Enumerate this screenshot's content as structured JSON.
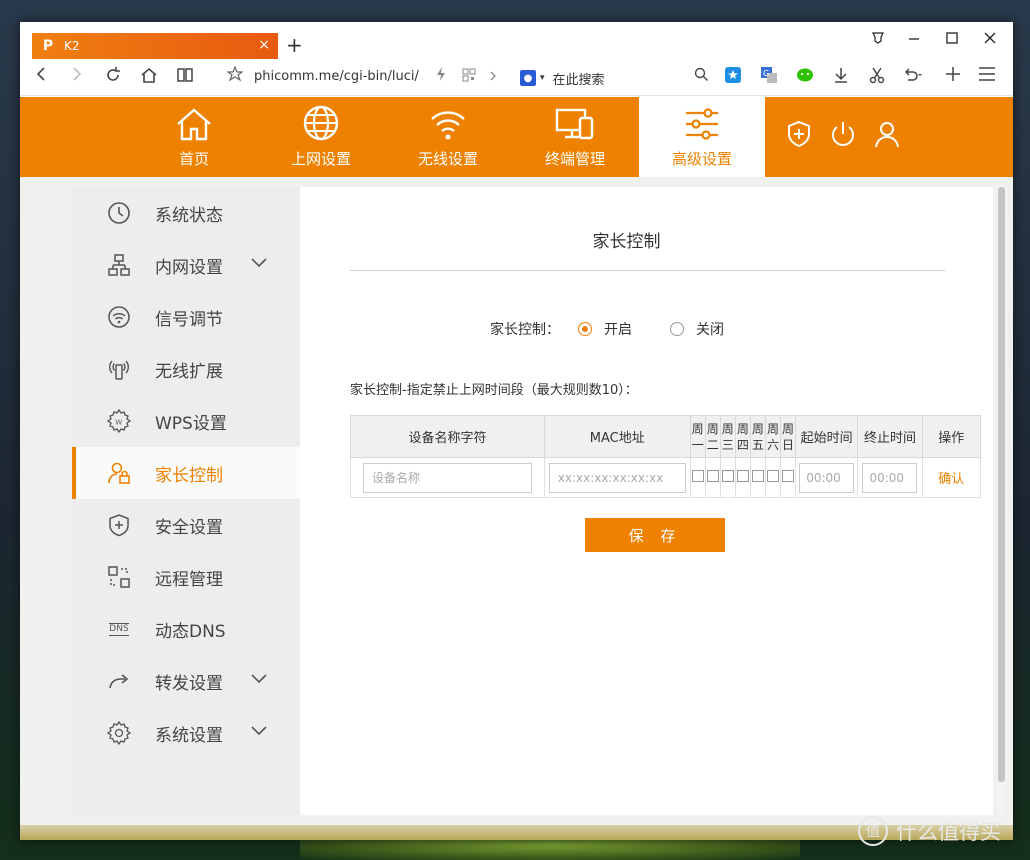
{
  "browser": {
    "tab_title": "K2",
    "tab_logo": "P",
    "tab_close": "×",
    "new_tab": "+",
    "address": "phicomm.me/cgi-bin/luci/",
    "search_placeholder": "在此搜索"
  },
  "header": {
    "menu": [
      {
        "label": "首页",
        "icon": "home-icon"
      },
      {
        "label": "上网设置",
        "icon": "globe-icon"
      },
      {
        "label": "无线设置",
        "icon": "wifi-icon"
      },
      {
        "label": "终端管理",
        "icon": "devices-icon"
      },
      {
        "label": "高级设置",
        "icon": "sliders-icon",
        "active": true
      }
    ]
  },
  "sidebar": {
    "items": [
      {
        "label": "系统状态",
        "icon": "clock-icon"
      },
      {
        "label": "内网设置",
        "icon": "network-icon",
        "expandable": true
      },
      {
        "label": "信号调节",
        "icon": "signal-icon"
      },
      {
        "label": "无线扩展",
        "icon": "extender-icon"
      },
      {
        "label": "WPS设置",
        "icon": "wps-gear-icon"
      },
      {
        "label": "家长控制",
        "icon": "parent-lock-icon",
        "active": true
      },
      {
        "label": "安全设置",
        "icon": "shield-plus-icon"
      },
      {
        "label": "远程管理",
        "icon": "remote-icon"
      },
      {
        "label": "动态DNS",
        "icon": "dns-icon",
        "icon_text": "DNS"
      },
      {
        "label": "转发设置",
        "icon": "forward-icon",
        "expandable": true
      },
      {
        "label": "系统设置",
        "icon": "gear-icon",
        "expandable": true
      }
    ]
  },
  "main": {
    "title": "家长控制",
    "parental_control_label": "家长控制：",
    "option_on": "开启",
    "option_off": "关闭",
    "selected": "开启",
    "rule_note": "家长控制-指定禁止上网时间段（最大规则数10）：",
    "table": {
      "headers": {
        "device_name": "设备名称字符",
        "mac": "MAC地址",
        "days": [
          [
            "周",
            "一"
          ],
          [
            "周",
            "二"
          ],
          [
            "周",
            "三"
          ],
          [
            "周",
            "四"
          ],
          [
            "周",
            "五"
          ],
          [
            "周",
            "六"
          ],
          [
            "周",
            "日"
          ]
        ],
        "start_time": "起始时间",
        "end_time": "终止时间",
        "action": "操作"
      },
      "row": {
        "device_placeholder": "设备名称",
        "mac_placeholder": "xx:xx:xx:xx:xx:xx",
        "start_placeholder": "00:00",
        "end_placeholder": "00:00",
        "confirm": "确认"
      }
    },
    "save_button": "保 存"
  },
  "watermark": {
    "text": "什么值得买",
    "icon": "值"
  },
  "colors": {
    "accent": "#ee8100",
    "tab_gradient_start": "#f07f10",
    "tab_gradient_end": "#e85a10"
  }
}
